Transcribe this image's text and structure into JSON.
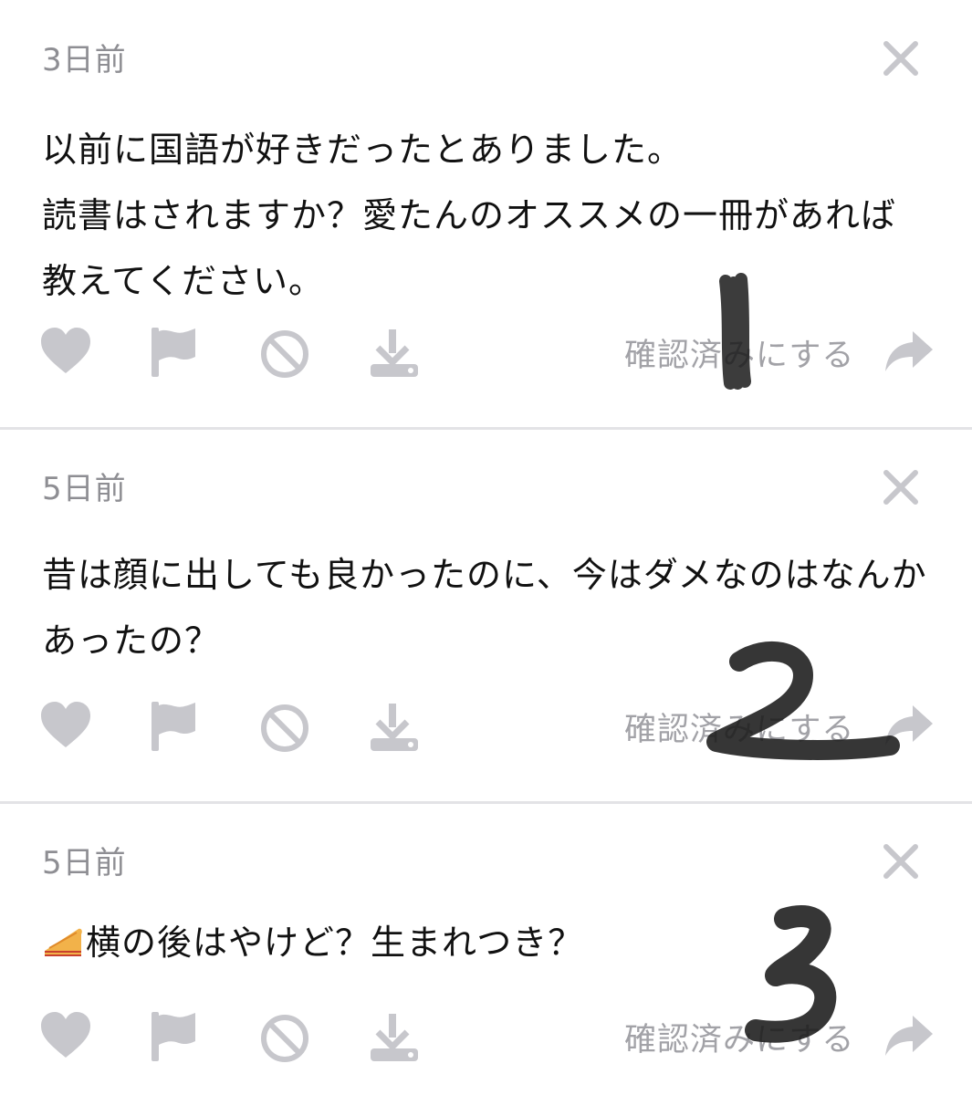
{
  "questions": [
    {
      "time": "3日前",
      "text": "以前に国語が好きだったとありました。\n読書はされますか？愛たんのオススメの一冊があれば教えてください。",
      "confirm_label": "確認済みにする"
    },
    {
      "time": "5日前",
      "text": "昔は顔に出しても良かったのに、今はダメなのはなんかあったの？",
      "confirm_label": "確認済みにする"
    },
    {
      "time": "5日前",
      "text": "横の後はやけど？生まれつき？",
      "confirm_label": "確認済みにする"
    }
  ],
  "icons": {
    "close": "close-icon",
    "like": "heart-icon",
    "flag": "flag-icon",
    "block": "block-icon",
    "download": "download-icon",
    "share": "share-arrow-icon",
    "emoji": "pie-emoji-icon"
  },
  "colors": {
    "icon_gray": "#c7c7cc",
    "text_gray": "#8e8e93",
    "divider": "#e3e3e6",
    "text": "#111111"
  }
}
